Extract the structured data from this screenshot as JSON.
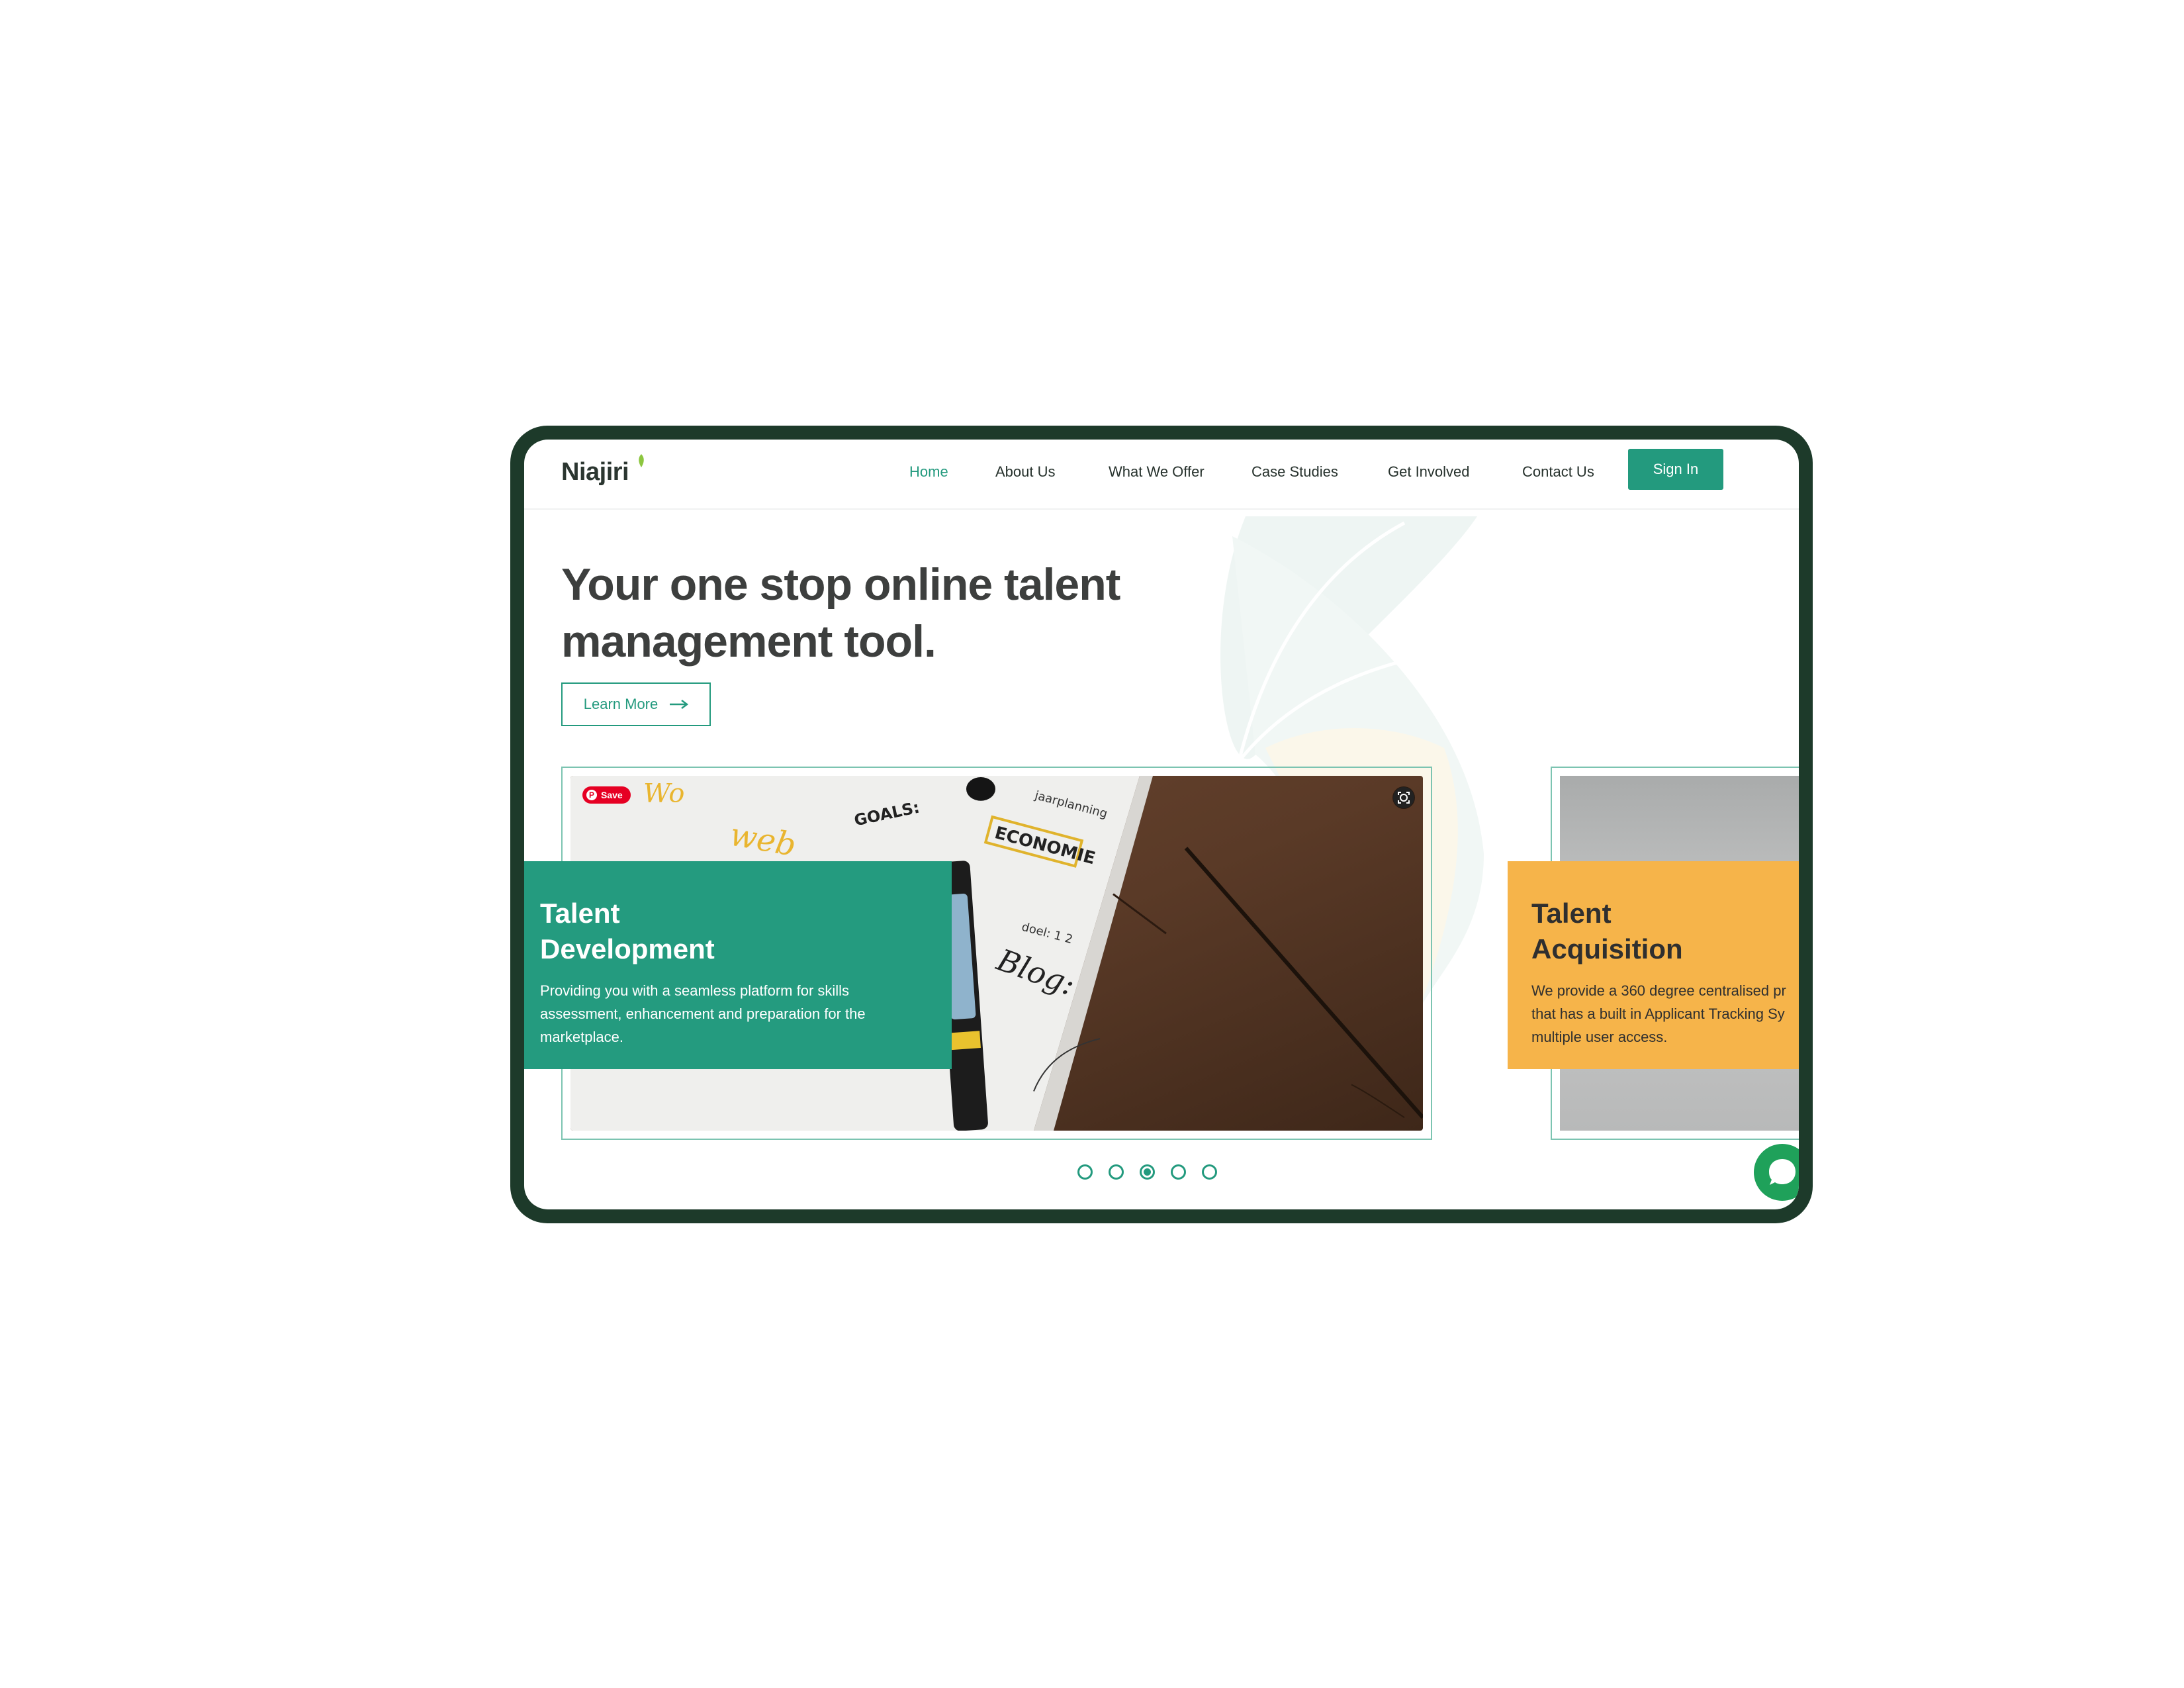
{
  "brand": {
    "name": "Niajiri",
    "accent": "#239a7e",
    "frame": "#1d3a2a",
    "green_card": "#249b7f",
    "yellow_card": "#f6b44a"
  },
  "nav": {
    "items": [
      {
        "label": "Home",
        "active": true
      },
      {
        "label": "About Us"
      },
      {
        "label": "What We Offer"
      },
      {
        "label": "Case Studies"
      },
      {
        "label": "Get Involved"
      },
      {
        "label": "Contact Us"
      }
    ],
    "signin_label": "Sign In"
  },
  "hero": {
    "title_line1": "Your one stop online talent",
    "title_line2": "management tool.",
    "cta_label": "Learn More",
    "cta_icon": "arrow-right-icon"
  },
  "cards": [
    {
      "title": "Talent Development",
      "text_line1": "Providing you with a seamless platform for skills",
      "text_line2": "assessment, enhancement and preparation for the",
      "text_line3": "marketplace.",
      "image_badge": "Save"
    },
    {
      "title": "Talent Acquisition",
      "text_line1": "We provide a 360 degree centralised pr",
      "text_line2": "that has a built in Applicant Tracking Sy",
      "text_line3": "multiple user access."
    }
  ],
  "carousel": {
    "count": 5,
    "active_index": 2
  },
  "chat": {
    "icon": "chat-bubble-icon"
  }
}
